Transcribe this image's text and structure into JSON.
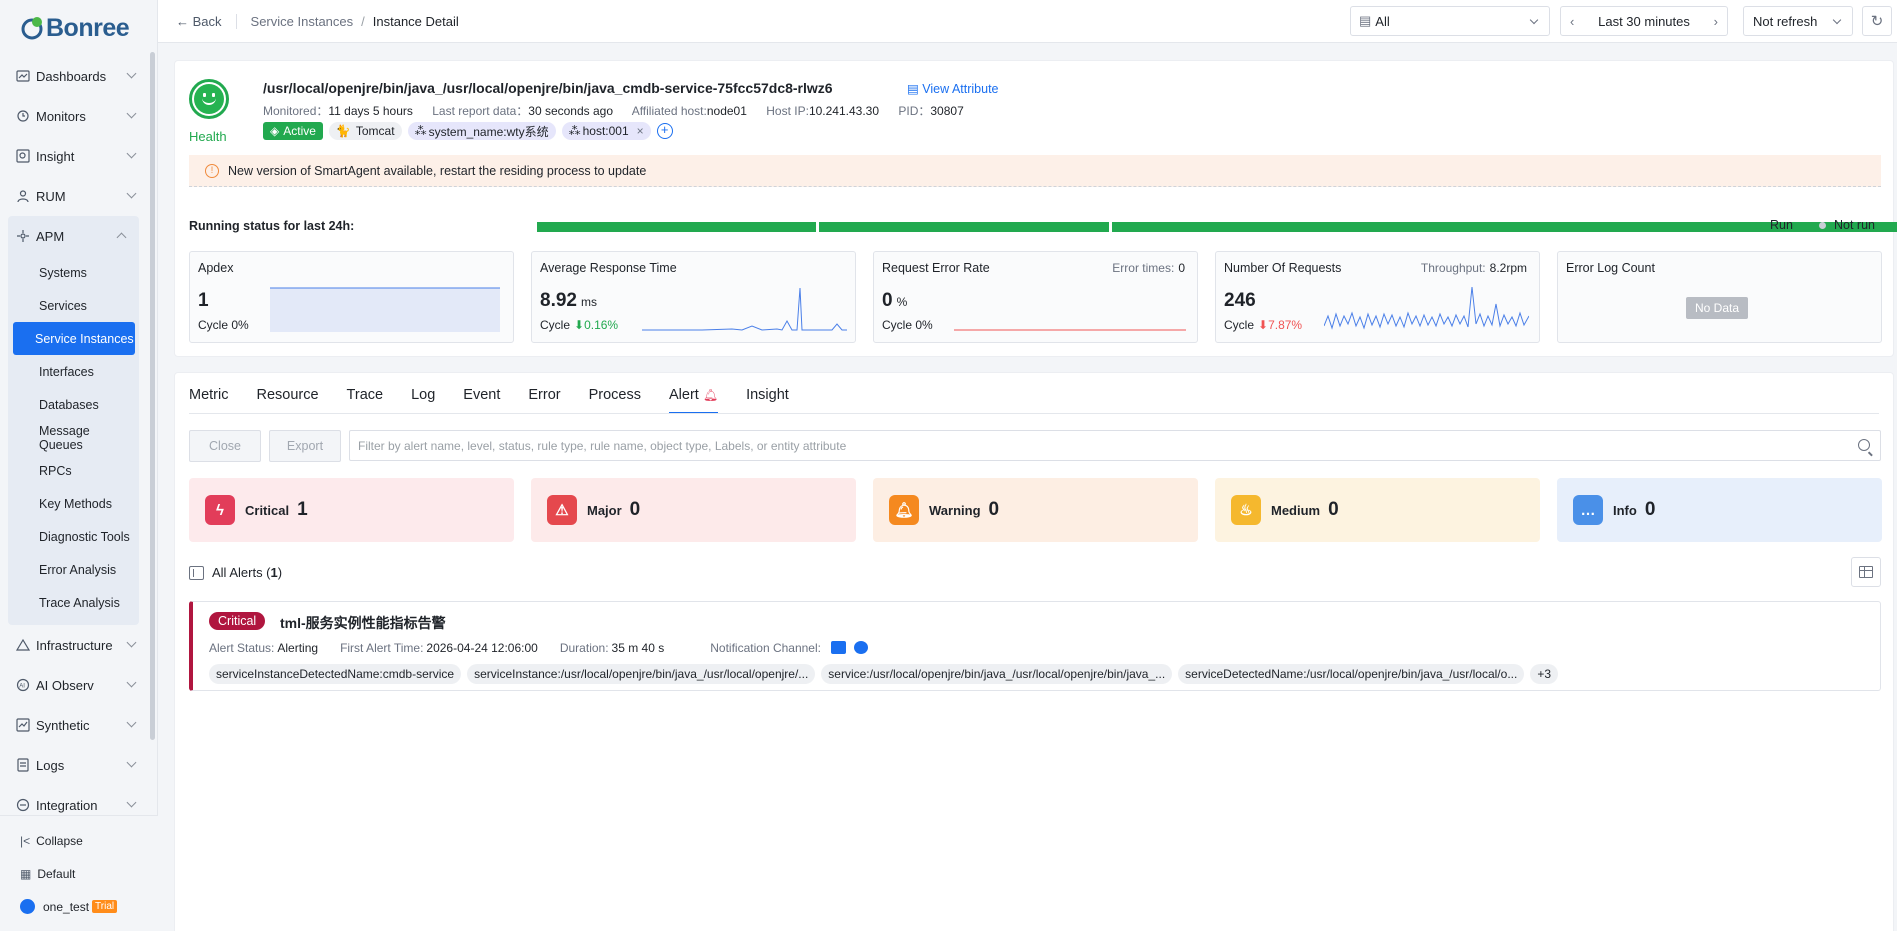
{
  "brand": {
    "name": "Bonree"
  },
  "sidebar": {
    "items": [
      {
        "label": "Dashboards",
        "icon": "dashboard-icon"
      },
      {
        "label": "Monitors",
        "icon": "monitor-icon"
      },
      {
        "label": "Insight",
        "icon": "insight-icon"
      },
      {
        "label": "RUM",
        "icon": "rum-icon"
      }
    ],
    "apm": {
      "label": "APM",
      "icon": "apm-icon",
      "children": [
        "Systems",
        "Services",
        "Service Instances",
        "Interfaces",
        "Databases",
        "Message Queues",
        "RPCs",
        "Key Methods",
        "Diagnostic Tools",
        "Error Analysis",
        "Trace Analysis"
      ]
    },
    "items_after": [
      {
        "label": "Infrastructure",
        "icon": "infrastructure-icon"
      },
      {
        "label": "AI Observ",
        "icon": "ai-icon"
      },
      {
        "label": "Synthetic",
        "icon": "synthetic-icon"
      },
      {
        "label": "Logs",
        "icon": "logs-icon"
      },
      {
        "label": "Integration",
        "icon": "integration-icon"
      }
    ],
    "collapse": "Collapse",
    "workspace": "Default",
    "user": "one_test",
    "trial": "Trial"
  },
  "topbar": {
    "back": "Back",
    "crumb_parent": "Service Instances",
    "crumb_sep": "/",
    "crumb_current": "Instance Detail",
    "scope": "All",
    "time_range": "Last 30 minutes",
    "refresh": "Not refresh"
  },
  "instance": {
    "title": "/usr/local/openjre/bin/java_/usr/local/openjre/bin/java_cmdb-service-75fcc57dc8-rlwz6",
    "view_attr": "View Attribute",
    "health": "Health",
    "monitored_label": "Monitored：",
    "monitored": "11 days 5 hours",
    "last_report_label": "Last report data：",
    "last_report": "30 seconds ago",
    "host_label": "Affiliated host:",
    "host": "node01",
    "ip_label": "Host IP:",
    "ip": "10.241.43.30",
    "pid_label": "PID：",
    "pid": "30807",
    "tags": [
      "Active",
      "Tomcat",
      "system_name:wty系统",
      "host:001"
    ],
    "notice": "New version of SmartAgent available, restart the residing process to update"
  },
  "running": {
    "label": "Running status for last 24h:",
    "run": "Run",
    "not_run": "Not run",
    "colors": {
      "run": "#22a94f",
      "not_run": "#c9ced6"
    }
  },
  "metrics": {
    "apdex": {
      "title": "Apdex",
      "value": "1",
      "cycle": "Cycle 0%"
    },
    "art": {
      "title": "Average Response Time",
      "value": "8.92",
      "unit": "ms",
      "cycle": "Cycle",
      "delta": "0.16%"
    },
    "rer": {
      "title": "Request Error Rate",
      "side_label": "Error times:",
      "side_value": "0",
      "value": "0",
      "unit": "%",
      "cycle": "Cycle 0%"
    },
    "nor": {
      "title": "Number Of Requests",
      "side_label": "Throughput:",
      "side_value": "8.2rpm",
      "value": "246",
      "cycle": "Cycle",
      "delta": "7.87%"
    },
    "elc": {
      "title": "Error Log Count",
      "nodata": "No Data"
    }
  },
  "tabs": [
    "Metric",
    "Resource",
    "Trace",
    "Log",
    "Event",
    "Error",
    "Process",
    "Alert",
    "Insight"
  ],
  "alerts": {
    "close": "Close",
    "export": "Export",
    "filter_placeholder": "Filter by alert name, level, status, rule type, rule name, object type, Labels, or entity attribute",
    "severity": [
      {
        "name": "Critical",
        "count": "1",
        "color": "#e23d5a",
        "bg": "#fdeaec"
      },
      {
        "name": "Major",
        "count": "0",
        "color": "#e5484d",
        "bg": "#fdeaea"
      },
      {
        "name": "Warning",
        "count": "0",
        "color": "#f5891f",
        "bg": "#fdeee3"
      },
      {
        "name": "Medium",
        "count": "0",
        "color": "#f5b82e",
        "bg": "#fdf3e0"
      },
      {
        "name": "Info",
        "count": "0",
        "color": "#4a90e8",
        "bg": "#e7effb"
      }
    ],
    "all_label": "All Alerts (",
    "all_count": "1",
    "all_close": ")",
    "item": {
      "level": "Critical",
      "name": "tml-服务实例性能指标告警",
      "status_label": "Alert Status:",
      "status": "Alerting",
      "first_label": "First Alert Time:",
      "first": "2026-04-24 12:06:00",
      "duration_label": "Duration:",
      "duration": "35 m 40 s",
      "channel_label": "Notification Channel:",
      "labels": [
        "serviceInstanceDetectedName:cmdb-service",
        "serviceInstance:/usr/local/openjre/bin/java_/usr/local/openjre/...",
        "service:/usr/local/openjre/bin/java_/usr/local/openjre/bin/java_...",
        "serviceDetectedName:/usr/local/openjre/bin/java_/usr/local/o...",
        "+3"
      ]
    }
  }
}
